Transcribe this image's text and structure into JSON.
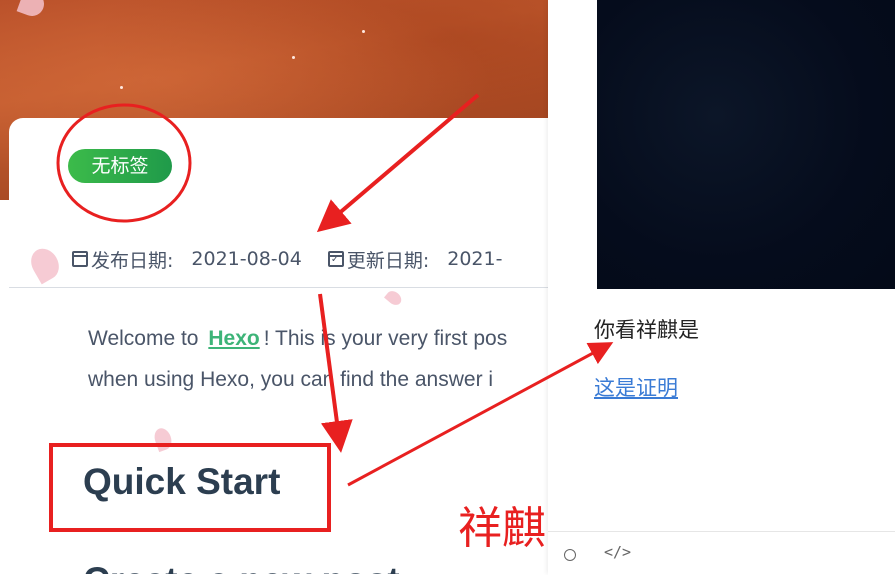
{
  "post": {
    "tag_badge": "无标签",
    "published_label": "发布日期:",
    "published_date": "2021-08-04",
    "updated_label": "更新日期:",
    "updated_date": "2021-",
    "intro_before": "Welcome to",
    "intro_link": "Hexo",
    "intro_after": "! This is your very first pos",
    "intro_line2": "when using Hexo, you can find the answer i",
    "heading": "Quick Start",
    "next_heading": "Create a new post"
  },
  "preview": {
    "caption": "你看祥麒是",
    "link": "这是证明"
  },
  "icons": {
    "published": "calendar-icon",
    "updated": "calendar-check-icon",
    "toolbar_left": "circle-icon",
    "toolbar_right": "code-icon"
  },
  "annotation": {
    "label": "祥麒",
    "color": "#e82020"
  }
}
